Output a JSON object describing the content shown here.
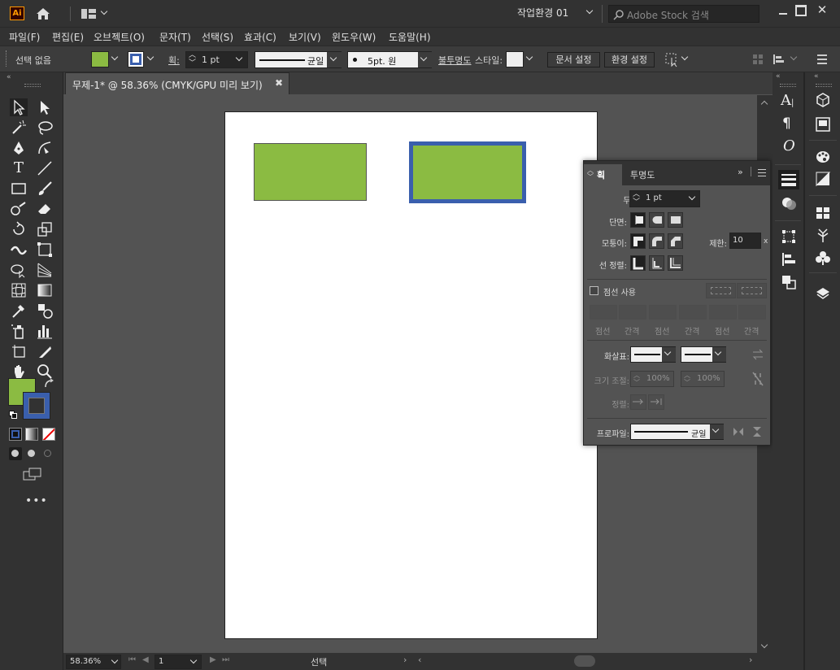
{
  "app": {
    "logo": "Ai",
    "workspace": "작업환경 01",
    "search_placeholder": "Adobe Stock 검색"
  },
  "menu": [
    "파일(F)",
    "편집(E)",
    "오브젝트(O)",
    "문자(T)",
    "선택(S)",
    "효과(C)",
    "보기(V)",
    "윈도우(W)",
    "도움말(H)"
  ],
  "control": {
    "selection_label": "선택 없음",
    "stroke_label": "획:",
    "stroke_value": "1 pt",
    "stroke_profile": "균일",
    "brush_value": "5pt. 원",
    "opacity_label": "불투명도",
    "style_label": "스타일:",
    "doc_setup": "문서 설정",
    "preferences": "환경 설정",
    "fill_color": "#8bbb42",
    "stroke_color": "#3a5fad"
  },
  "document": {
    "tab_title": "무제-1* @ 58.36% (CMYK/GPU 미리 보기)"
  },
  "status": {
    "zoom": "58.36%",
    "artboard": "1",
    "tool": "선택"
  },
  "stroke_panel": {
    "tab_stroke": "획",
    "tab_transparency": "투명도",
    "weight_label": "두께:",
    "weight_value": "1 pt",
    "cap_label": "단면:",
    "corner_label": "모퉁이:",
    "limit_label": "제한:",
    "limit_value": "10",
    "limit_unit": "x",
    "align_label": "선 정렬:",
    "dashed_label": "점선 사용",
    "dash_fields": [
      "점선",
      "간격",
      "점선",
      "간격",
      "점선",
      "간격"
    ],
    "arrows_label": "화살표:",
    "scale_label": "크기 조절:",
    "scale_value_1": "100%",
    "scale_value_2": "100%",
    "align_arrow_label": "정렬:",
    "profile_label": "프로파일:",
    "profile_value": "균일"
  }
}
